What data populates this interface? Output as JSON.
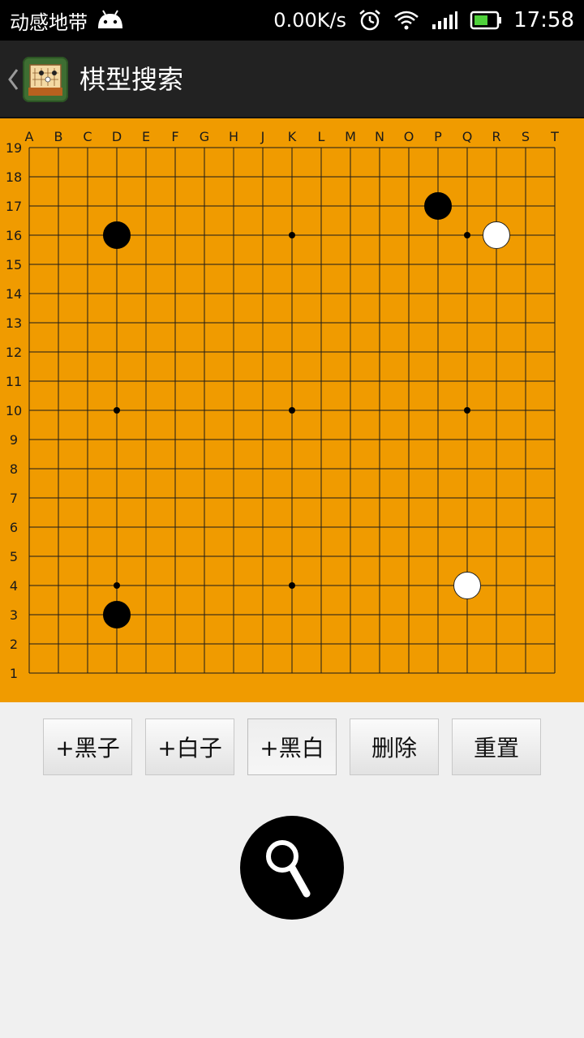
{
  "status_bar": {
    "carrier": "动感地带",
    "net_speed": "0.00K/s",
    "time": "17:58",
    "icons": [
      "android-icon",
      "alarm-icon",
      "wifi-icon",
      "signal-icon",
      "battery-icon"
    ]
  },
  "action_bar": {
    "title": "棋型搜索",
    "icon": "go-board-app-icon"
  },
  "board": {
    "background_color": "#f09b00",
    "size": 19,
    "column_labels": [
      "A",
      "B",
      "C",
      "D",
      "E",
      "F",
      "G",
      "H",
      "J",
      "K",
      "L",
      "M",
      "N",
      "O",
      "P",
      "Q",
      "R",
      "S",
      "T"
    ],
    "row_labels": [
      "19",
      "18",
      "17",
      "16",
      "15",
      "14",
      "13",
      "12",
      "11",
      "10",
      "9",
      "8",
      "7",
      "6",
      "5",
      "4",
      "3",
      "2",
      "1"
    ],
    "star_points": [
      "D16",
      "K16",
      "Q16",
      "D10",
      "K10",
      "Q10",
      "D4",
      "K4",
      "Q4"
    ],
    "stones": [
      {
        "point": "D16",
        "color": "black"
      },
      {
        "point": "P17",
        "color": "black"
      },
      {
        "point": "R16",
        "color": "white"
      },
      {
        "point": "Q4",
        "color": "white"
      },
      {
        "point": "D3",
        "color": "black"
      }
    ]
  },
  "toolbar": {
    "add_black_label": "+黑子",
    "add_white_label": "+白子",
    "add_alternate_label": "+黑白",
    "delete_label": "删除",
    "reset_label": "重置",
    "active_tool": "add_alternate"
  },
  "search_button": {
    "icon": "search-icon"
  }
}
